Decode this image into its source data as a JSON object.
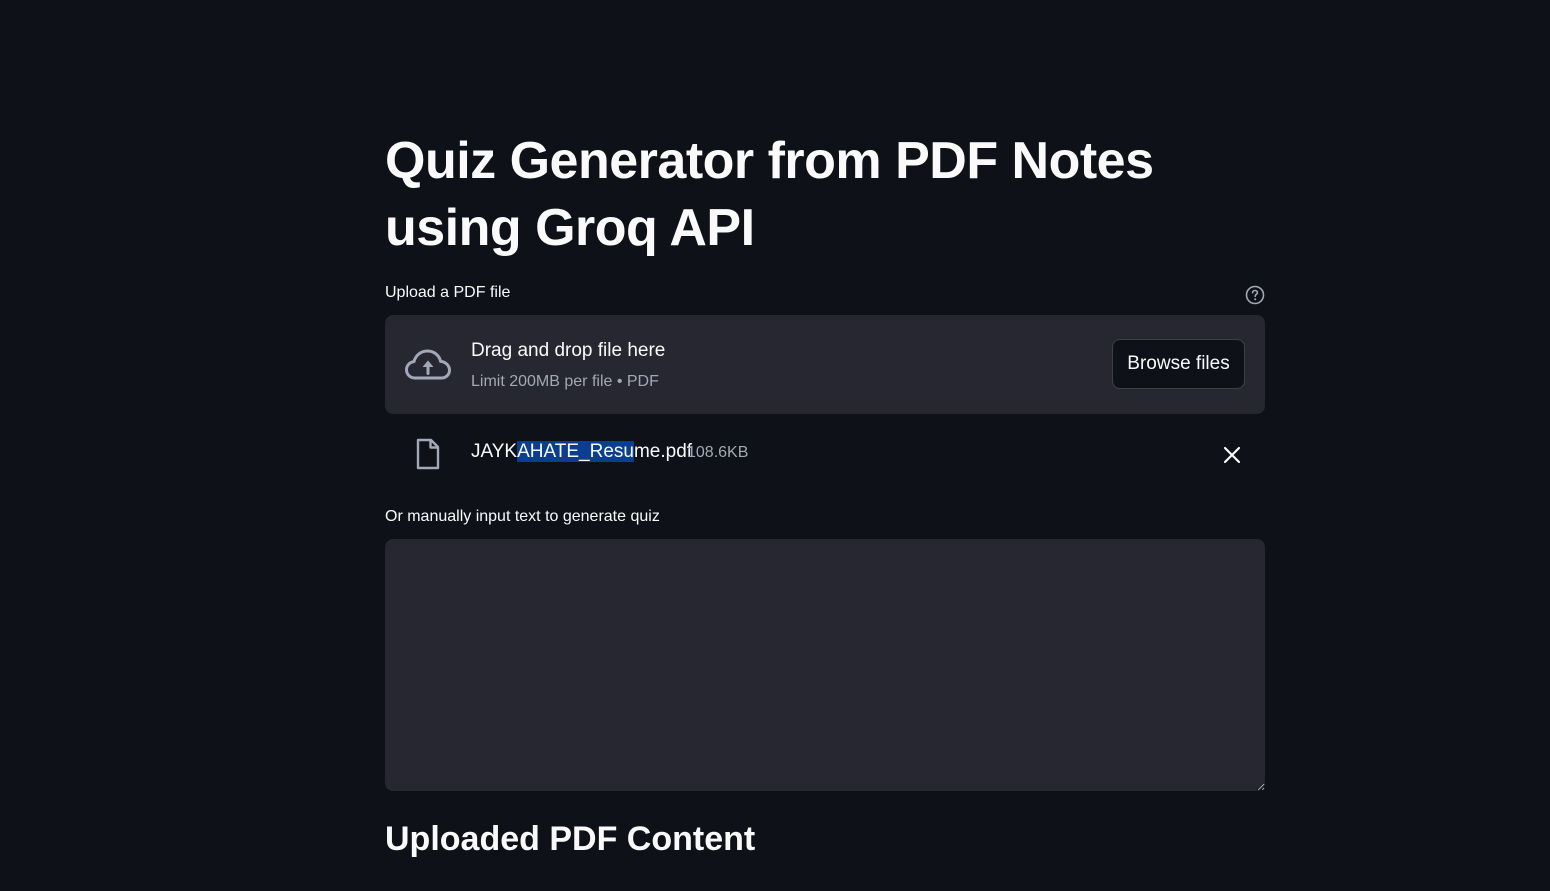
{
  "page": {
    "title": "Quiz Generator from PDF Notes using Groq API"
  },
  "uploader": {
    "label": "Upload a PDF file",
    "help_icon": "question-circle-icon",
    "dropzone_title": "Drag and drop file here",
    "dropzone_limit": "Limit 200MB per file • PDF",
    "browse_label": "Browse files",
    "upload_icon": "cloud-upload-icon"
  },
  "uploaded_file": {
    "name_before": "JAYK",
    "name_highlight": "AHATE_Resu",
    "name_after": "me.pdf",
    "size": "108.6KB",
    "file_icon": "file-icon",
    "remove_icon": "close-icon"
  },
  "manual_input": {
    "label": "Or manually input text to generate quiz",
    "value": ""
  },
  "sections": {
    "uploaded_content_heading": "Uploaded PDF Content"
  },
  "colors": {
    "background": "#0e1117",
    "panel": "#262730",
    "text": "#fafafa",
    "muted": "#a3a8b8",
    "selection": "#0b3d91"
  }
}
